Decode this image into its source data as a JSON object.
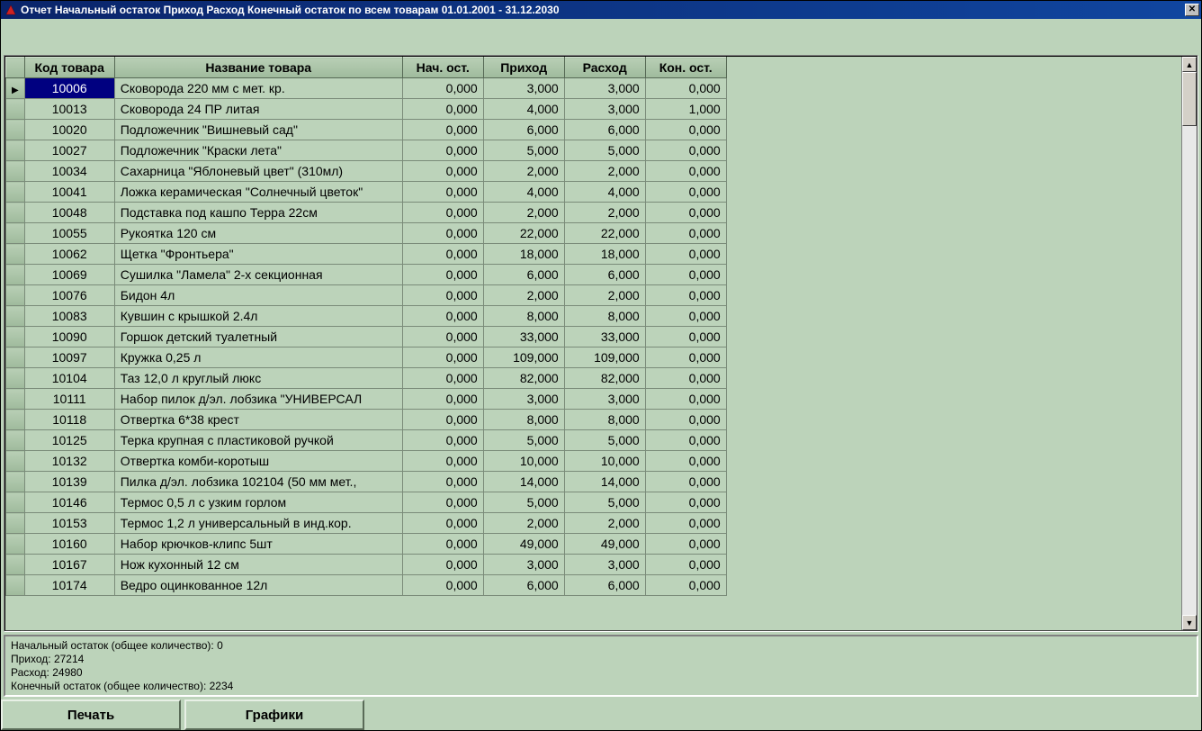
{
  "window": {
    "title": "Отчет Начальный остаток Приход Расход Конечный остаток по всем товарам   01.01.2001 - 31.12.2030"
  },
  "columns": {
    "code": "Код товара",
    "name": "Название товара",
    "start": "Нач. ост.",
    "in": "Приход",
    "out": "Расход",
    "end": "Кон. ост."
  },
  "rows": [
    {
      "code": "10006",
      "name": "Сковорода 220 мм с мет. кр.",
      "start": "0,000",
      "in": "3,000",
      "out": "3,000",
      "end": "0,000",
      "selected": true
    },
    {
      "code": "10013",
      "name": "Сковорода 24 ПР литая",
      "start": "0,000",
      "in": "4,000",
      "out": "3,000",
      "end": "1,000"
    },
    {
      "code": "10020",
      "name": "Подложечник \"Вишневый сад\"",
      "start": "0,000",
      "in": "6,000",
      "out": "6,000",
      "end": "0,000"
    },
    {
      "code": "10027",
      "name": "Подложечник \"Краски лета\"",
      "start": "0,000",
      "in": "5,000",
      "out": "5,000",
      "end": "0,000"
    },
    {
      "code": "10034",
      "name": "Сахарница \"Яблоневый цвет\" (310мл)",
      "start": "0,000",
      "in": "2,000",
      "out": "2,000",
      "end": "0,000"
    },
    {
      "code": "10041",
      "name": "Ложка керамическая \"Солнечный цветок\"",
      "start": "0,000",
      "in": "4,000",
      "out": "4,000",
      "end": "0,000"
    },
    {
      "code": "10048",
      "name": "Подставка под кашпо Терра 22см",
      "start": "0,000",
      "in": "2,000",
      "out": "2,000",
      "end": "0,000"
    },
    {
      "code": "10055",
      "name": "Рукоятка 120 см",
      "start": "0,000",
      "in": "22,000",
      "out": "22,000",
      "end": "0,000"
    },
    {
      "code": "10062",
      "name": "Щетка \"Фронтьера\"",
      "start": "0,000",
      "in": "18,000",
      "out": "18,000",
      "end": "0,000"
    },
    {
      "code": "10069",
      "name": "Сушилка \"Ламела\" 2-х секционная",
      "start": "0,000",
      "in": "6,000",
      "out": "6,000",
      "end": "0,000"
    },
    {
      "code": "10076",
      "name": "Бидон 4л",
      "start": "0,000",
      "in": "2,000",
      "out": "2,000",
      "end": "0,000"
    },
    {
      "code": "10083",
      "name": "Кувшин с крышкой 2.4л",
      "start": "0,000",
      "in": "8,000",
      "out": "8,000",
      "end": "0,000"
    },
    {
      "code": "10090",
      "name": "Горшок детский туалетный",
      "start": "0,000",
      "in": "33,000",
      "out": "33,000",
      "end": "0,000"
    },
    {
      "code": "10097",
      "name": "Кружка 0,25 л",
      "start": "0,000",
      "in": "109,000",
      "out": "109,000",
      "end": "0,000"
    },
    {
      "code": "10104",
      "name": "Таз 12,0 л круглый люкс",
      "start": "0,000",
      "in": "82,000",
      "out": "82,000",
      "end": "0,000"
    },
    {
      "code": "10111",
      "name": "Набор пилок д/эл. лобзика \"УНИВЕРСАЛ",
      "start": "0,000",
      "in": "3,000",
      "out": "3,000",
      "end": "0,000"
    },
    {
      "code": "10118",
      "name": "Отвертка 6*38 крест",
      "start": "0,000",
      "in": "8,000",
      "out": "8,000",
      "end": "0,000"
    },
    {
      "code": "10125",
      "name": "Терка крупная с пластиковой ручкой",
      "start": "0,000",
      "in": "5,000",
      "out": "5,000",
      "end": "0,000"
    },
    {
      "code": "10132",
      "name": "Отвертка комби-коротыш",
      "start": "0,000",
      "in": "10,000",
      "out": "10,000",
      "end": "0,000"
    },
    {
      "code": "10139",
      "name": "Пилка д/эл. лобзика 102104 (50 мм мет.,",
      "start": "0,000",
      "in": "14,000",
      "out": "14,000",
      "end": "0,000"
    },
    {
      "code": "10146",
      "name": "Термос 0,5 л с узким горлом",
      "start": "0,000",
      "in": "5,000",
      "out": "5,000",
      "end": "0,000"
    },
    {
      "code": "10153",
      "name": "Термос 1,2 л универсальный в инд.кор.",
      "start": "0,000",
      "in": "2,000",
      "out": "2,000",
      "end": "0,000"
    },
    {
      "code": "10160",
      "name": "Набор крючков-клипс 5шт",
      "start": "0,000",
      "in": "49,000",
      "out": "49,000",
      "end": "0,000"
    },
    {
      "code": "10167",
      "name": "Нож кухонный 12 см",
      "start": "0,000",
      "in": "3,000",
      "out": "3,000",
      "end": "0,000"
    },
    {
      "code": "10174",
      "name": "Ведро оцинкованное 12л",
      "start": "0,000",
      "in": "6,000",
      "out": "6,000",
      "end": "0,000"
    }
  ],
  "summary": {
    "line1": "Начальный остаток (общее количество): 0",
    "line2": "Приход: 27214",
    "line3": "Расход: 24980",
    "line4": "Конечный остаток (общее количество): 2234"
  },
  "buttons": {
    "print": "Печать",
    "charts": "Графики"
  }
}
